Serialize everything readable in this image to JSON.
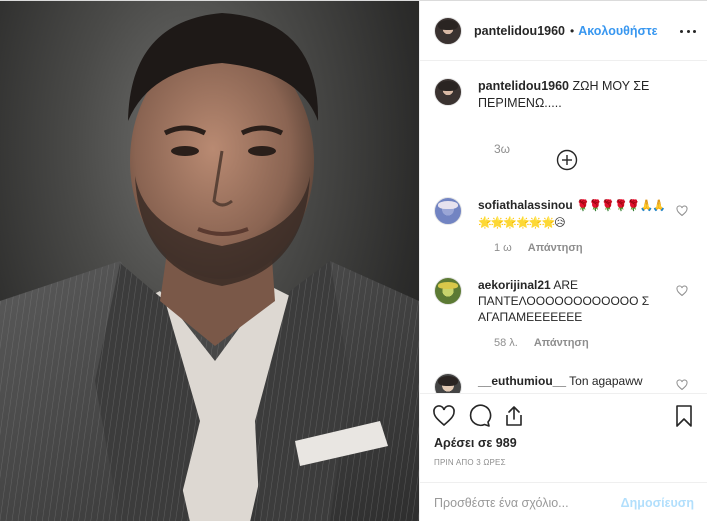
{
  "post": {
    "author": {
      "username": "pantelidou1960",
      "follow_label": "Ακολουθήστε",
      "separator": "•"
    },
    "caption": {
      "username": "pantelidou1960",
      "text": "ΖΩΗ ΜΟΥ ΣΕ ΠΕΡΙΜΕΝΩ.....",
      "time": "3ω"
    },
    "comments": [
      {
        "username": "sofiathalassinou",
        "text": "🌹🌹🌹🌹🌹🙏🙏 🌟🌟🌟🌟🌟🌟😥",
        "time": "1 ω",
        "reply_label": "Απάντηση"
      },
      {
        "username": "aekorijinal21",
        "text": "ARE ΠΑΝΤΕΛΟΟΟΟΟΟΟΟΟΟΟΟ Σ ΑΓΑΠΑΜΕΕΕΕΕΕΕ",
        "time": "58 λ.",
        "reply_label": "Απάντηση"
      },
      {
        "username": "__euthumiou__",
        "text": "Ton agapaww",
        "time": "",
        "reply_label": ""
      }
    ],
    "likes": "Αρέσει σε 989",
    "posted": "ΠΡΙΝ ΑΠΟ 3 ΩΡΕΣ",
    "add_comment": {
      "placeholder": "Προσθέστε ένα σχόλιο...",
      "publish_label": "Δημοσίευση"
    },
    "icons": {
      "more": "more-options-icon",
      "load_more": "plus-circle-icon",
      "like": "heart-icon",
      "comment": "comment-icon",
      "share": "share-icon",
      "save": "bookmark-icon"
    },
    "colors": {
      "accent": "#3897f0",
      "publish_disabled": "#b2dffc",
      "muted": "#8e8e8e",
      "text": "#262626"
    }
  }
}
